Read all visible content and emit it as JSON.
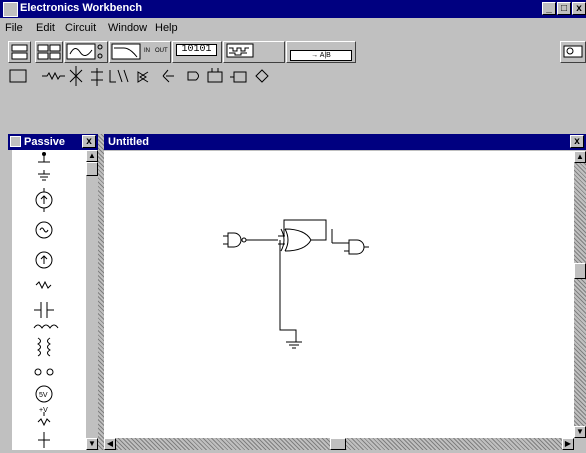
{
  "window": {
    "title": "Electronics Workbench",
    "min": "_",
    "max": "□",
    "close": "x"
  },
  "menu": [
    "File",
    "Edit",
    "Circuit",
    "Window",
    "Help"
  ],
  "toolbar": {
    "wordgen_label": "10101",
    "logic_label": "→ A|B",
    "bode_labels": [
      "IN",
      "OUT"
    ]
  },
  "parts_bin": {
    "title": "Passive",
    "close": "x",
    "battery_label": "5V",
    "vcc_label": "+V"
  },
  "circuit_window": {
    "title": "Untitled",
    "close": "x"
  },
  "icons": [
    "app-icon",
    "new-icon",
    "oscilloscope-icon",
    "bode-plotter-icon",
    "word-generator-icon",
    "logic-analyzer-icon",
    "logic-converter-icon",
    "multimeter-icon"
  ]
}
